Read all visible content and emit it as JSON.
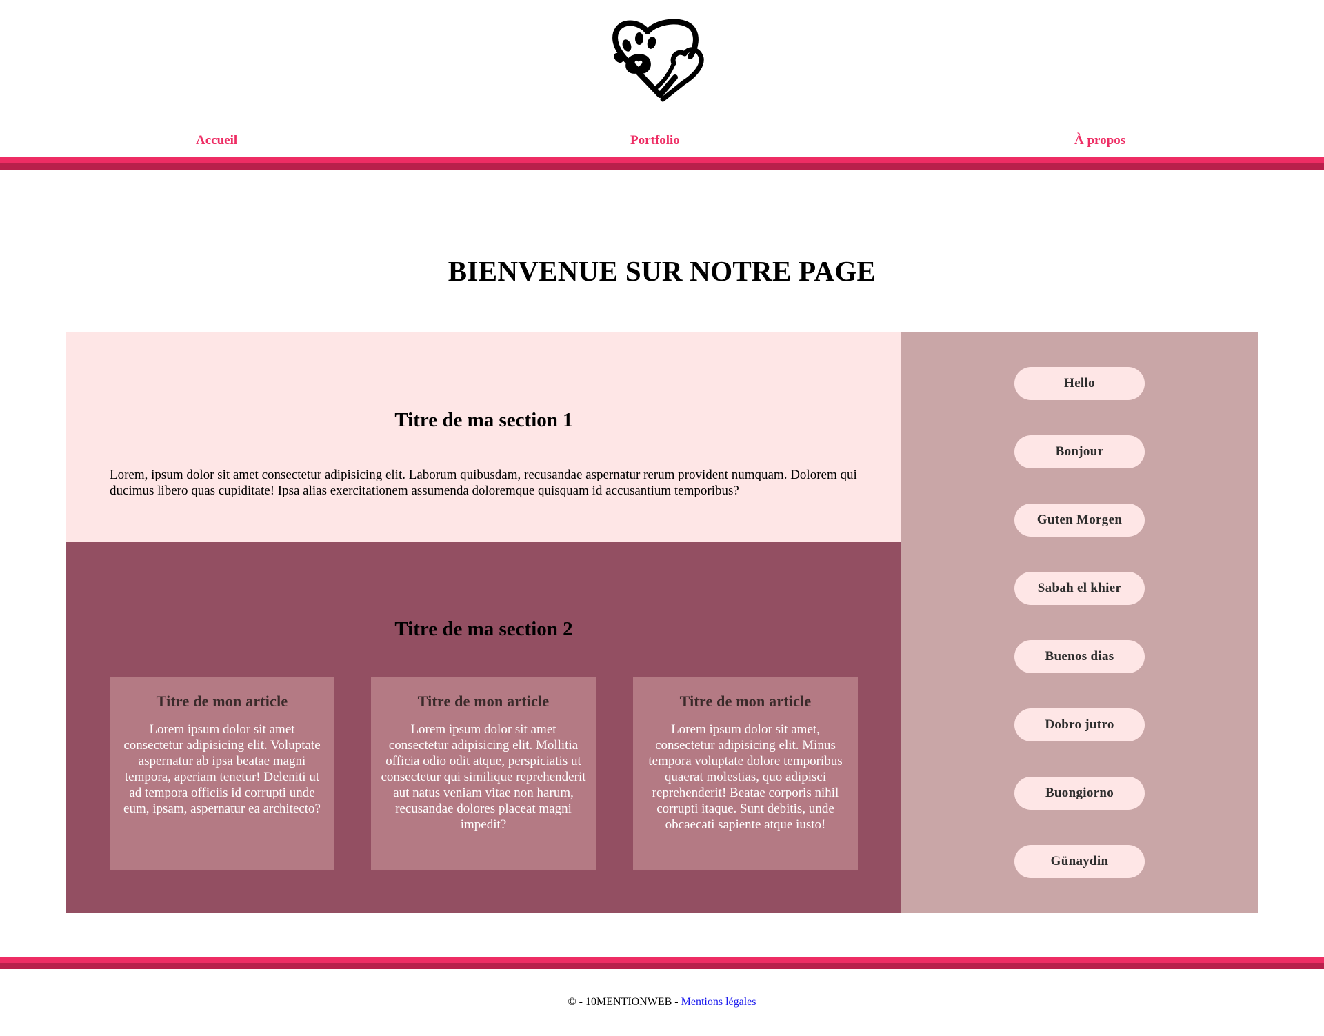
{
  "header": {
    "logo_icon": "paw-heart-logo-icon",
    "nav": [
      {
        "label": "Accueil"
      },
      {
        "label": "Portfolio"
      },
      {
        "label": "À propos"
      }
    ],
    "band_colors": [
      "#ee2d64",
      "#b8204b"
    ]
  },
  "main": {
    "title": "BIENVENUE SUR NOTRE PAGE",
    "section1": {
      "title": "Titre de ma section 1",
      "text": "Lorem, ipsum dolor sit amet consectetur adipisicing elit. Laborum quibusdam, recusandae aspernatur rerum provident numquam. Dolorem qui ducimus libero quas cupiditate! Ipsa alias exercitationem assumenda doloremque quisquam id accusantium temporibus?"
    },
    "section2": {
      "title": "Titre de ma section 2",
      "articles": [
        {
          "title": "Titre de mon article",
          "text": "Lorem ipsum dolor sit amet consectetur adipisicing elit. Voluptate aspernatur ab ipsa beatae magni tempora, aperiam tenetur! Deleniti ut ad tempora officiis id corrupti unde eum, ipsam, aspernatur ea architecto?"
        },
        {
          "title": "Titre de mon article",
          "text": "Lorem ipsum dolor sit amet consectetur adipisicing elit. Mollitia officia odio odit atque, perspiciatis ut consectetur qui similique reprehenderit aut natus veniam vitae non harum, recusandae dolores placeat magni impedit?"
        },
        {
          "title": "Titre de mon article",
          "text": "Lorem ipsum dolor sit amet, consectetur adipisicing elit. Minus tempora voluptate dolore temporibus quaerat molestias, quo adipisci reprehenderit! Beatae corporis nihil corrupti itaque. Sunt debitis, unde obcaecati sapiente atque iusto!"
        }
      ]
    },
    "aside": {
      "greetings": [
        "Hello",
        "Bonjour",
        "Guten Morgen",
        "Sabah el khier",
        "Buenos dias",
        "Dobro jutro",
        "Buongiorno",
        "Günaydin"
      ]
    }
  },
  "footer": {
    "copyright": "© - 10MENTIONWEB - ",
    "legal_link": "Mentions légales"
  },
  "colors": {
    "accent": "#ee2d64",
    "section1_bg": "#fee6e6",
    "section2_bg": "#934f62",
    "article_bg": "#b47a84",
    "aside_bg": "#c9a6a7"
  }
}
